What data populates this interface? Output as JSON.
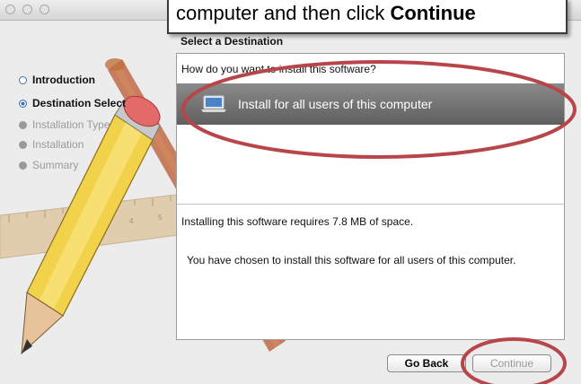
{
  "callout": {
    "text_prefix": "computer and then click ",
    "text_bold": "Continue"
  },
  "header": {
    "title": "Select a Destination"
  },
  "sidebar": {
    "items": [
      {
        "label": "Introduction",
        "state": "done"
      },
      {
        "label": "Destination Select",
        "state": "current"
      },
      {
        "label": "Installation Type",
        "state": "todo"
      },
      {
        "label": "Installation",
        "state": "todo"
      },
      {
        "label": "Summary",
        "state": "todo"
      }
    ]
  },
  "main": {
    "question": "How do you want to install this software?",
    "option_label": "Install for all users of this computer",
    "space_text": "Installing this software requires 7.8 MB of space.",
    "chosen_text": "You have chosen to install this software for all users of this computer."
  },
  "buttons": {
    "back_label": "Go Back",
    "continue_label": "Continue"
  },
  "colors": {
    "annotation": "#b8454a",
    "sidebar_bullet": "#3d6fb8",
    "option_bg": "#6e6e6e"
  }
}
